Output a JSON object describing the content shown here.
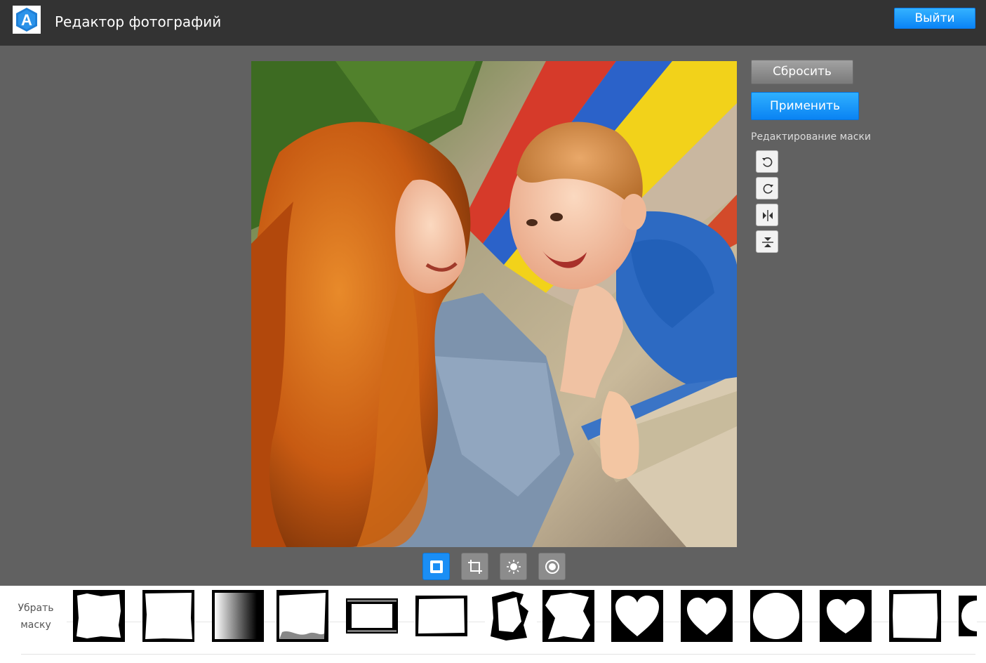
{
  "header": {
    "logo_letter": "A",
    "title": "Редактор фотографий",
    "exit_label": "Выйти"
  },
  "panel": {
    "reset_label": "Сбросить",
    "apply_label": "Применить",
    "mask_edit_label": "Редактирование маски",
    "tools": [
      "rotate-left-icon",
      "rotate-right-icon",
      "flip-horizontal-icon",
      "flip-vertical-icon"
    ]
  },
  "modes": {
    "items": [
      "mask-frame-icon",
      "crop-icon",
      "brightness-icon",
      "vignette-icon"
    ],
    "active": "mask-frame-icon"
  },
  "strip": {
    "remove_line1": "Убрать",
    "remove_line2": "маску",
    "thumbnails_count": 13
  },
  "colors": {
    "accent": "#1a8ef5",
    "topbar": "#333333",
    "workspace": "#616161"
  }
}
